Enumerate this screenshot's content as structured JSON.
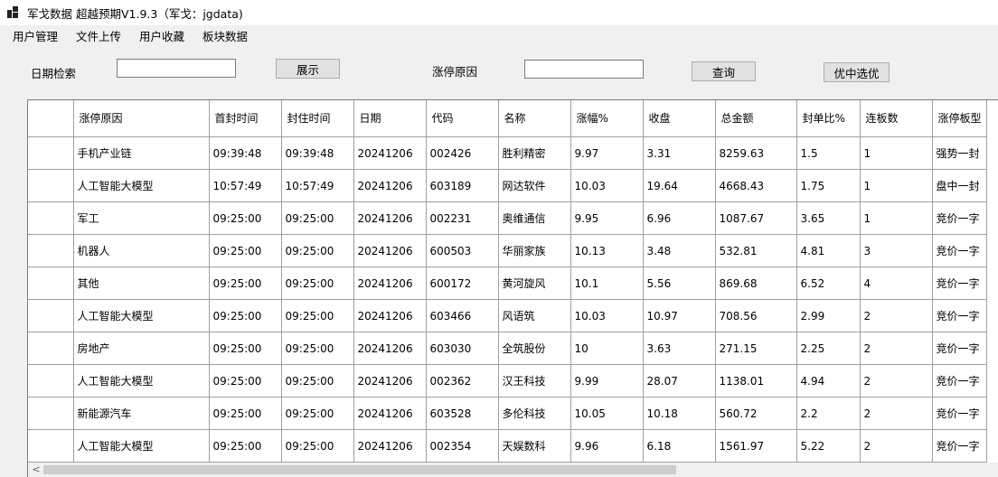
{
  "window": {
    "title": "军戈数据 超越预期V1.9.3（军戈：jgdata)"
  },
  "menu": [
    "用户管理",
    "文件上传",
    "用户收藏",
    "板块数据"
  ],
  "search": {
    "date_label": "日期检索",
    "date_value": "",
    "show_button": "展示",
    "reason_label": "涨停原因",
    "reason_value": "",
    "query_button": "查询",
    "selected_button": "优中选优"
  },
  "table": {
    "columns": [
      "",
      "涨停原因",
      "首封时间",
      "封住时间",
      "日期",
      "代码",
      "名称",
      "涨幅%",
      "收盘",
      "总金额",
      "封单比%",
      "连板数",
      "涨停板型"
    ],
    "rows": [
      [
        "",
        "手机产业链",
        "09:39:48",
        "09:39:48",
        "20241206",
        "002426",
        "胜利精密",
        "9.97",
        "3.31",
        "8259.63",
        "1.5",
        "1",
        "强势一封"
      ],
      [
        "",
        "人工智能大模型",
        "10:57:49",
        "10:57:49",
        "20241206",
        "603189",
        "网达软件",
        "10.03",
        "19.64",
        "4668.43",
        "1.75",
        "1",
        "盘中一封"
      ],
      [
        "",
        "军工",
        "09:25:00",
        "09:25:00",
        "20241206",
        "002231",
        "奥维通信",
        "9.95",
        "6.96",
        "1087.67",
        "3.65",
        "1",
        "竞价一字"
      ],
      [
        "",
        "机器人",
        "09:25:00",
        "09:25:00",
        "20241206",
        "600503",
        "华丽家族",
        "10.13",
        "3.48",
        "532.81",
        "4.81",
        "3",
        "竞价一字"
      ],
      [
        "",
        "其他",
        "09:25:00",
        "09:25:00",
        "20241206",
        "600172",
        "黄河旋风",
        "10.1",
        "5.56",
        "869.68",
        "6.52",
        "4",
        "竞价一字"
      ],
      [
        "",
        "人工智能大模型",
        "09:25:00",
        "09:25:00",
        "20241206",
        "603466",
        "风语筑",
        "10.03",
        "10.97",
        "708.56",
        "2.99",
        "2",
        "竞价一字"
      ],
      [
        "",
        "房地产",
        "09:25:00",
        "09:25:00",
        "20241206",
        "603030",
        "全筑股份",
        "10",
        "3.63",
        "271.15",
        "2.25",
        "2",
        "竞价一字"
      ],
      [
        "",
        "人工智能大模型",
        "09:25:00",
        "09:25:00",
        "20241206",
        "002362",
        "汉王科技",
        "9.99",
        "28.07",
        "1138.01",
        "4.94",
        "2",
        "竞价一字"
      ],
      [
        "",
        "新能源汽车",
        "09:25:00",
        "09:25:00",
        "20241206",
        "603528",
        "多伦科技",
        "10.05",
        "10.18",
        "560.72",
        "2.2",
        "2",
        "竞价一字"
      ],
      [
        "",
        "人工智能大模型",
        "09:25:00",
        "09:25:00",
        "20241206",
        "002354",
        "天娱数科",
        "9.96",
        "6.18",
        "1561.97",
        "5.22",
        "2",
        "竞价一字"
      ]
    ]
  },
  "scrollbar": {
    "left_arrow_icon": "chevron-left-icon",
    "left_arrow_glyph": "<"
  }
}
